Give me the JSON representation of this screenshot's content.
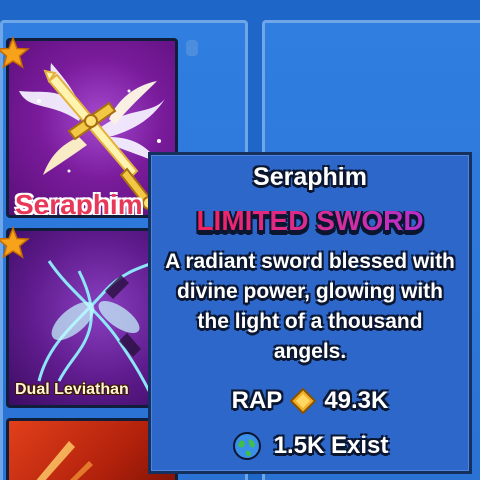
{
  "inventory": {
    "items": [
      {
        "name": "Seraphim",
        "starred": true
      },
      {
        "name": "Dual Leviathan",
        "starred": true
      },
      {
        "name": "",
        "starred": false
      }
    ]
  },
  "tooltip": {
    "title": "Seraphim",
    "rarity": "LIMITED SWORD",
    "description": "A radiant sword blessed with divine power, glowing with the light of a thousand angels.",
    "rap_label": "RAP",
    "rap_value": "49.3K",
    "exist_value": "1.5K Exist"
  },
  "icons": {
    "star": "star-icon",
    "diamond": "diamond-icon",
    "globe": "globe-icon"
  },
  "colors": {
    "background": "#1f66c9",
    "rarity_gradient_start": "#ff1f4a",
    "rarity_gradient_end": "#a42fe6",
    "star": "#f7a21b"
  }
}
